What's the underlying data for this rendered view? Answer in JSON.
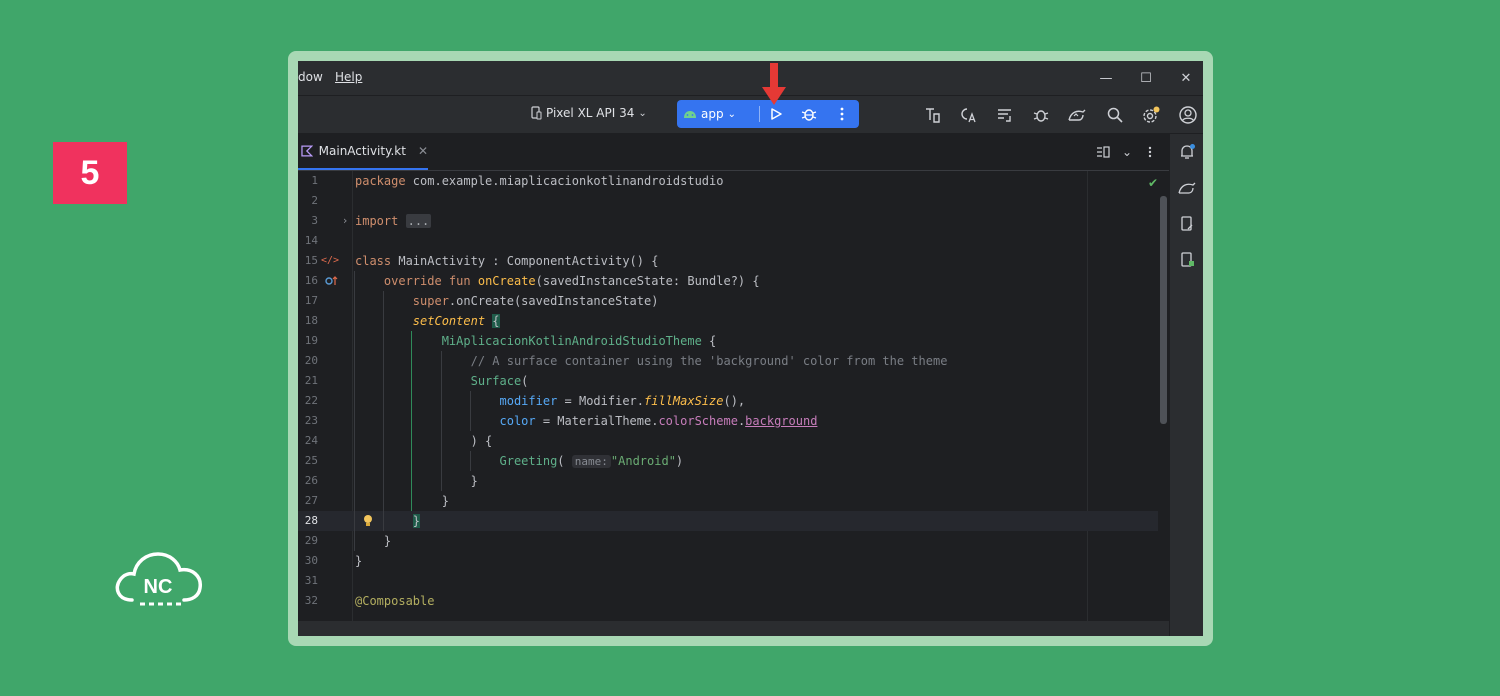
{
  "step_badge": "5",
  "logo_text": "NC",
  "colors": {
    "background": "#40a66a",
    "badge": "#f0325e",
    "run_group": "#3574f0",
    "arrow": "#e53935"
  },
  "menu": {
    "partial_item": "dow",
    "help_label": "Help"
  },
  "window_controls": {
    "minimize": "—",
    "maximize": "☐",
    "close": "✕"
  },
  "toolbar": {
    "device_label": "Pixel XL API 34",
    "run_config_label": "app",
    "icons": [
      "project-structure-icon",
      "translate-icon",
      "sync-icon",
      "bug-icon",
      "profile-icon",
      "search-icon",
      "settings-icon",
      "account-icon"
    ]
  },
  "editor": {
    "tab_label": "MainActivity.kt",
    "lines": [
      {
        "n": "1"
      },
      {
        "n": "2"
      },
      {
        "n": "3"
      },
      {
        "n": "14"
      },
      {
        "n": "15"
      },
      {
        "n": "16"
      },
      {
        "n": "17"
      },
      {
        "n": "18"
      },
      {
        "n": "19"
      },
      {
        "n": "20"
      },
      {
        "n": "21"
      },
      {
        "n": "22"
      },
      {
        "n": "23"
      },
      {
        "n": "24"
      },
      {
        "n": "25"
      },
      {
        "n": "26"
      },
      {
        "n": "27"
      },
      {
        "n": "28"
      },
      {
        "n": "29"
      },
      {
        "n": "30"
      },
      {
        "n": "31"
      },
      {
        "n": "32"
      }
    ],
    "code": {
      "l1_kw": "package",
      "l1_rest": " com.example.miaplicacionkotlinandroidstudio",
      "l3_kw": "import",
      "l3_fold": "...",
      "l15_kw": "class",
      "l15_rest": " MainActivity : ComponentActivity() {",
      "l16_kw": "override fun",
      "l16_fn": "onCreate",
      "l16_rest": "(savedInstanceState: Bundle?) {",
      "l17_kw": "super",
      "l17_rest": ".onCreate(savedInstanceState)",
      "l18_fn": "setContent",
      "l18_brace": "{",
      "l19_comp": "MiAplicacionKotlinAndroidStudioTheme",
      "l19_rest": " {",
      "l20_comment": "// A surface container using the 'background' color from the theme",
      "l21_comp": "Surface",
      "l21_rest": "(",
      "l22_param": "modifier",
      "l22_eq": " = Modifier.",
      "l22_fn": "fillMaxSize",
      "l22_rest": "(),",
      "l23_param": "color",
      "l23_eq": " = MaterialTheme.",
      "l23_ext": "colorScheme",
      "l23_dot": ".",
      "l23_prop": "background",
      "l24": ") {",
      "l25_comp": "Greeting",
      "l25_open": "(",
      "l25_hint": "name:",
      "l25_str": "\"Android\"",
      "l25_close": ")",
      "l26": "}",
      "l27": "}",
      "l28": "}",
      "l29": "}",
      "l30": "}",
      "l32": "@Composable"
    }
  }
}
